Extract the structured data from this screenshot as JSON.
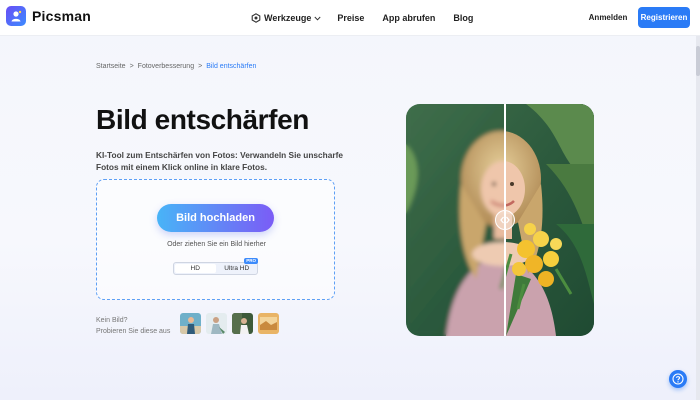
{
  "brand": {
    "name": "Picsman",
    "accent": "#2a7bf6"
  },
  "nav": {
    "items": [
      {
        "label": "Werkzeuge",
        "icon": "tools-icon",
        "has_dropdown": true
      },
      {
        "label": "Preise"
      },
      {
        "label": "App abrufen"
      },
      {
        "label": "Blog"
      }
    ]
  },
  "auth": {
    "login_label": "Anmelden",
    "register_label": "Registrieren"
  },
  "breadcrumb": {
    "items": [
      "Startseite",
      "Fotoverbesserung",
      "Bild entschärfen"
    ],
    "separator": ">"
  },
  "hero": {
    "title": "Bild entschärfen",
    "subtitle": "KI-Tool zum Entschärfen von Fotos: Verwandeln Sie unscharfe Fotos mit einem Klick online in klare Fotos."
  },
  "upload": {
    "button_label": "Bild hochladen",
    "drop_hint": "Oder ziehen Sie ein Bild hierher",
    "quality_options": [
      "HD",
      "Ultra HD"
    ],
    "selected_quality": "HD",
    "pro_badge": "PRO"
  },
  "samples": {
    "label_line1": "Kein Bild?",
    "label_line2": "Probieren Sie diese aus",
    "items": [
      "sample-image-1",
      "sample-image-2",
      "sample-image-3",
      "sample-image-4"
    ]
  },
  "compare": {
    "subject": "before-after-portrait",
    "handle_icon": "compare-arrows-icon"
  },
  "help": {
    "icon": "help-icon"
  }
}
